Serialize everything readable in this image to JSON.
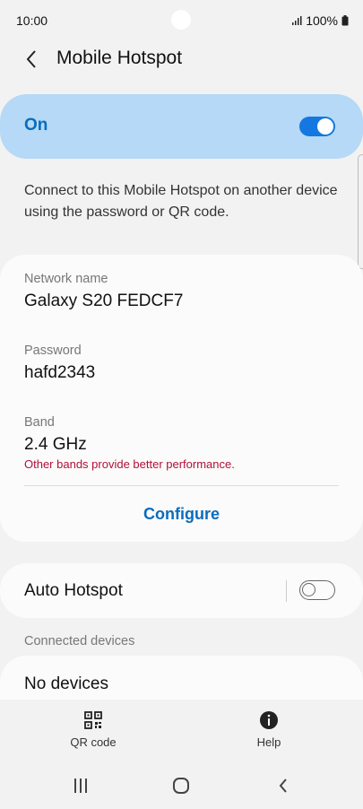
{
  "status": {
    "time": "10:00",
    "battery": "100%",
    "signal_icon": "signal-icon",
    "battery_icon": "battery-icon"
  },
  "header": {
    "title": "Mobile Hotspot",
    "back_icon": "back-icon"
  },
  "master_toggle": {
    "label": "On",
    "state": true,
    "accent": "#1478e0",
    "card_color": "#b5d9f6"
  },
  "description": "Connect to this Mobile Hotspot on another device using the password or QR code.",
  "info": {
    "network_name_label": "Network name",
    "network_name_value": "Galaxy S20 FEDCF7",
    "password_label": "Password",
    "password_value": "hafd2343",
    "band_label": "Band",
    "band_value": "2.4 GHz",
    "band_note": "Other bands provide better performance.",
    "configure_label": "Configure"
  },
  "auto_hotspot": {
    "label": "Auto Hotspot",
    "state": false
  },
  "connected": {
    "header": "Connected devices",
    "empty_label": "No devices"
  },
  "actions": {
    "qr_label": "QR code",
    "qr_icon": "qr-code-icon",
    "help_label": "Help",
    "help_icon": "help-icon"
  },
  "nav": {
    "recents_icon": "recents-icon",
    "home_icon": "home-icon",
    "back_icon": "nav-back-icon"
  }
}
